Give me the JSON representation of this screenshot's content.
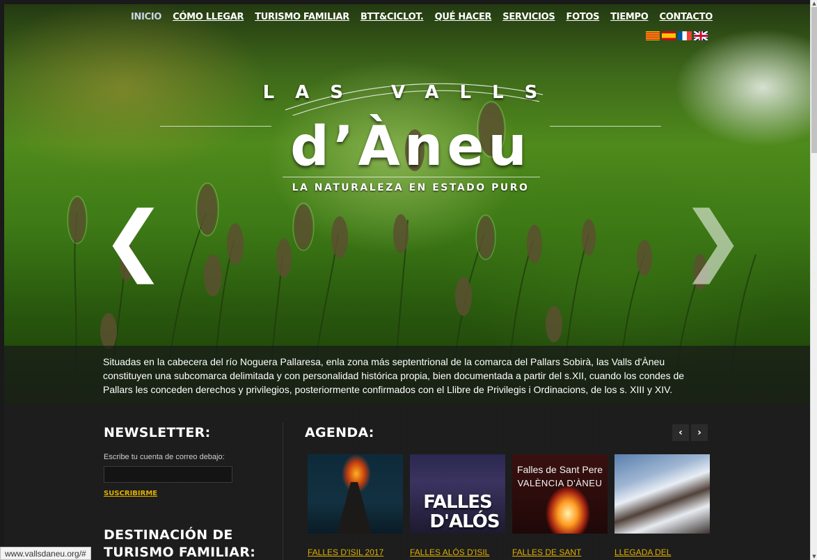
{
  "nav": {
    "items": [
      "INICIO",
      "CÓMO LLEGAR",
      "TURISMO FAMILIAR",
      "BTT&CICLOT.",
      "QUÉ HACER",
      "SERVICIOS",
      "FOTOS",
      "TIEMPO",
      "CONTACTO"
    ],
    "active_index": 0
  },
  "languages": [
    {
      "icon": "catalan-flag-icon"
    },
    {
      "icon": "spanish-flag-icon"
    },
    {
      "icon": "french-flag-icon"
    },
    {
      "icon": "uk-flag-icon"
    }
  ],
  "logo": {
    "top": "LAS VALLS",
    "main": "d’Àneu",
    "subtitle": "LA NATURALEZA EN ESTADO PURO"
  },
  "slider": {
    "prev_symbol": "❮",
    "next_symbol": "❯",
    "caption": "Situadas en la cabecera del río Noguera Pallaresa, enla zona más septentrional de la comarca del Pallars Sobirà, las Valls d'Àneu constituyen una subcomarca delimitada y con personalidad histórica propia, bien documentada a partir del s.XII, cuando los condes de Pallars les conceden derechos y privilegios, posteriormente confirmados con el Llibre de Privilegis i Ordinacions, de los s. XIII y XIV."
  },
  "newsletter": {
    "heading": "NEWSLETTER:",
    "label": "Escribe tu cuenta de correo debajo:",
    "input_value": "",
    "submit": "SUSCRIBIRME"
  },
  "family": {
    "heading_line1": "DESTINACIÓN DE",
    "heading_line2": "TURISMO FAMILIAR:"
  },
  "agenda": {
    "heading": "AGENDA:",
    "prev": "‹",
    "next": "›",
    "items": [
      {
        "title": "FALLES D'ISIL 2017",
        "image_text": ""
      },
      {
        "title": "FALLES ALÓS D'ISIL",
        "image_text_1": "FALLES",
        "image_text_2": "D'ALÓS"
      },
      {
        "title": "FALLES DE SANT",
        "image_text_1": "Falles de Sant Pere",
        "image_text_2": "VALÈNCIA D'ÀNEU"
      },
      {
        "title": "LLEGADA DEL",
        "image_text": ""
      }
    ]
  },
  "status_bar": {
    "url": "www.vallsdaneu.org/#"
  },
  "colors": {
    "accent": "#e0b000",
    "nav_active": "#c9d6e8",
    "background": "#1b1b1b"
  }
}
